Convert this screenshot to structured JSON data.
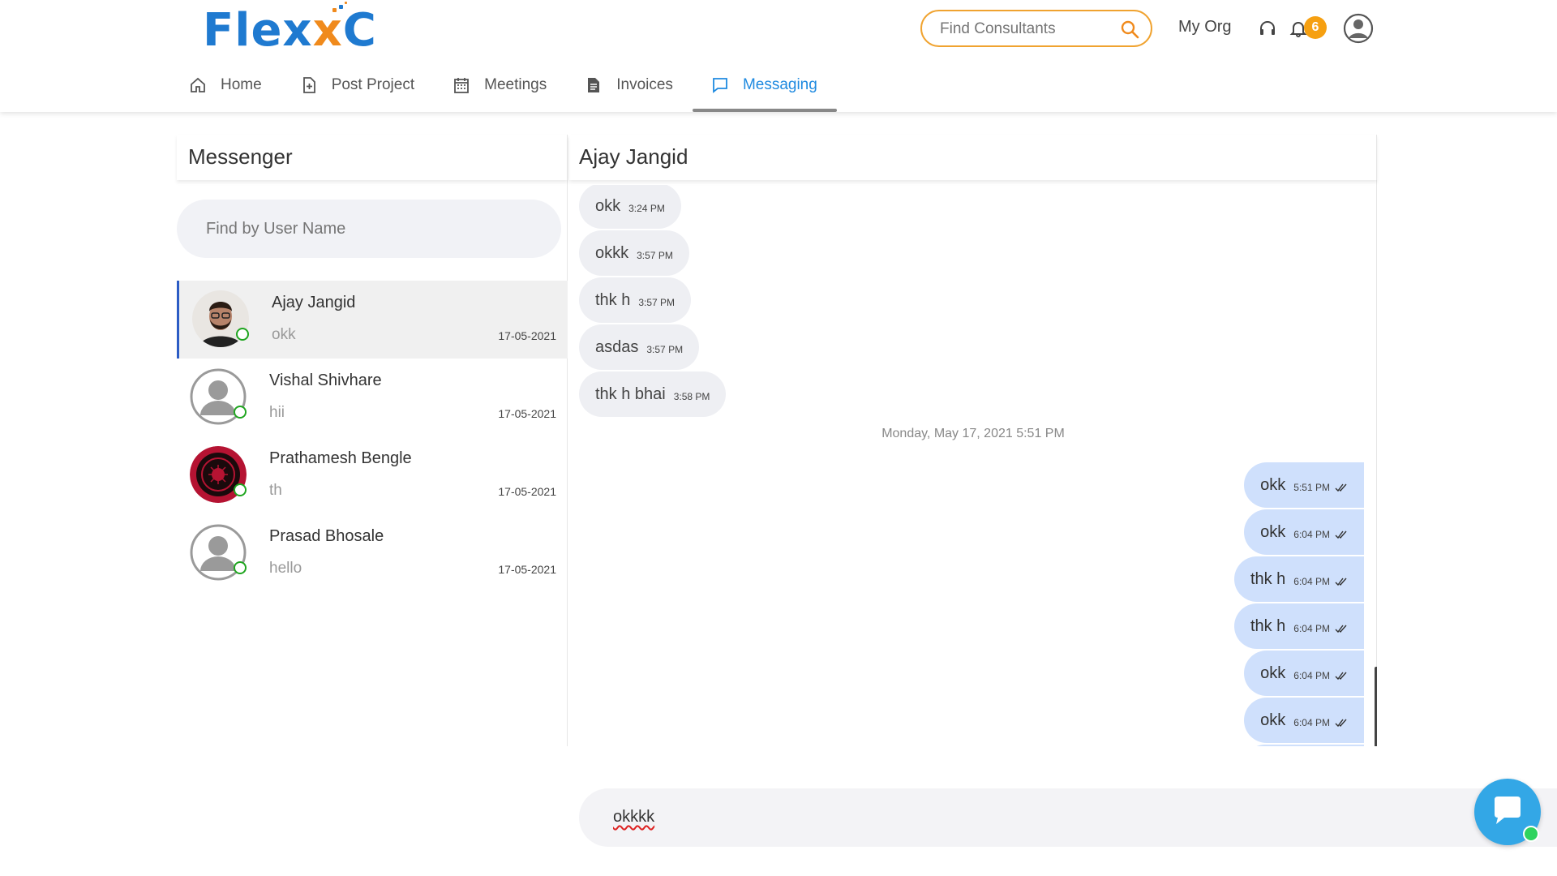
{
  "header": {
    "logo_text_a": "Flex",
    "logo_text_b": "C",
    "search_placeholder": "Find Consultants",
    "my_org": "My Org",
    "notification_count": "6"
  },
  "nav": [
    {
      "label": "Home",
      "icon": "home-icon"
    },
    {
      "label": "Post Project",
      "icon": "file-plus-icon"
    },
    {
      "label": "Meetings",
      "icon": "calendar-icon"
    },
    {
      "label": "Invoices",
      "icon": "document-icon"
    },
    {
      "label": "Messaging",
      "icon": "chat-icon",
      "active": true
    }
  ],
  "messenger": {
    "title": "Messenger",
    "search_placeholder": "Find by User Name",
    "contacts": [
      {
        "name": "Ajay Jangid",
        "last": "okk",
        "date": "17-05-2021"
      },
      {
        "name": "Vishal Shivhare",
        "last": "hii",
        "date": "17-05-2021"
      },
      {
        "name": "Prathamesh Bengle",
        "last": "th",
        "date": "17-05-2021"
      },
      {
        "name": "Prasad Bhosale",
        "last": "hello",
        "date": "17-05-2021"
      }
    ]
  },
  "chat": {
    "title": "Ajay Jangid",
    "incoming": [
      {
        "text": "okk",
        "time": "3:24 PM"
      },
      {
        "text": "okkk",
        "time": "3:57 PM"
      },
      {
        "text": "thk h",
        "time": "3:57 PM"
      },
      {
        "text": "asdas",
        "time": "3:57 PM"
      },
      {
        "text": "thk h bhai",
        "time": "3:58 PM"
      }
    ],
    "day_separator": "Monday, May 17, 2021 5:51 PM",
    "outgoing": [
      {
        "text": "okk",
        "time": "5:51 PM"
      },
      {
        "text": "okk",
        "time": "6:04 PM"
      },
      {
        "text": "thk h",
        "time": "6:04 PM"
      },
      {
        "text": "thk h",
        "time": "6:04 PM"
      },
      {
        "text": "okk",
        "time": "6:04 PM"
      },
      {
        "text": "okk",
        "time": "6:04 PM"
      }
    ],
    "composer_text": "okkkk"
  },
  "colors": {
    "accent": "#1f8ae0",
    "logo_blue": "#1f7ad0",
    "logo_orange": "#f08a1c",
    "badge": "#f6a011",
    "online": "#1fa51f",
    "outgoing_bubble": "#cfe0fc"
  }
}
